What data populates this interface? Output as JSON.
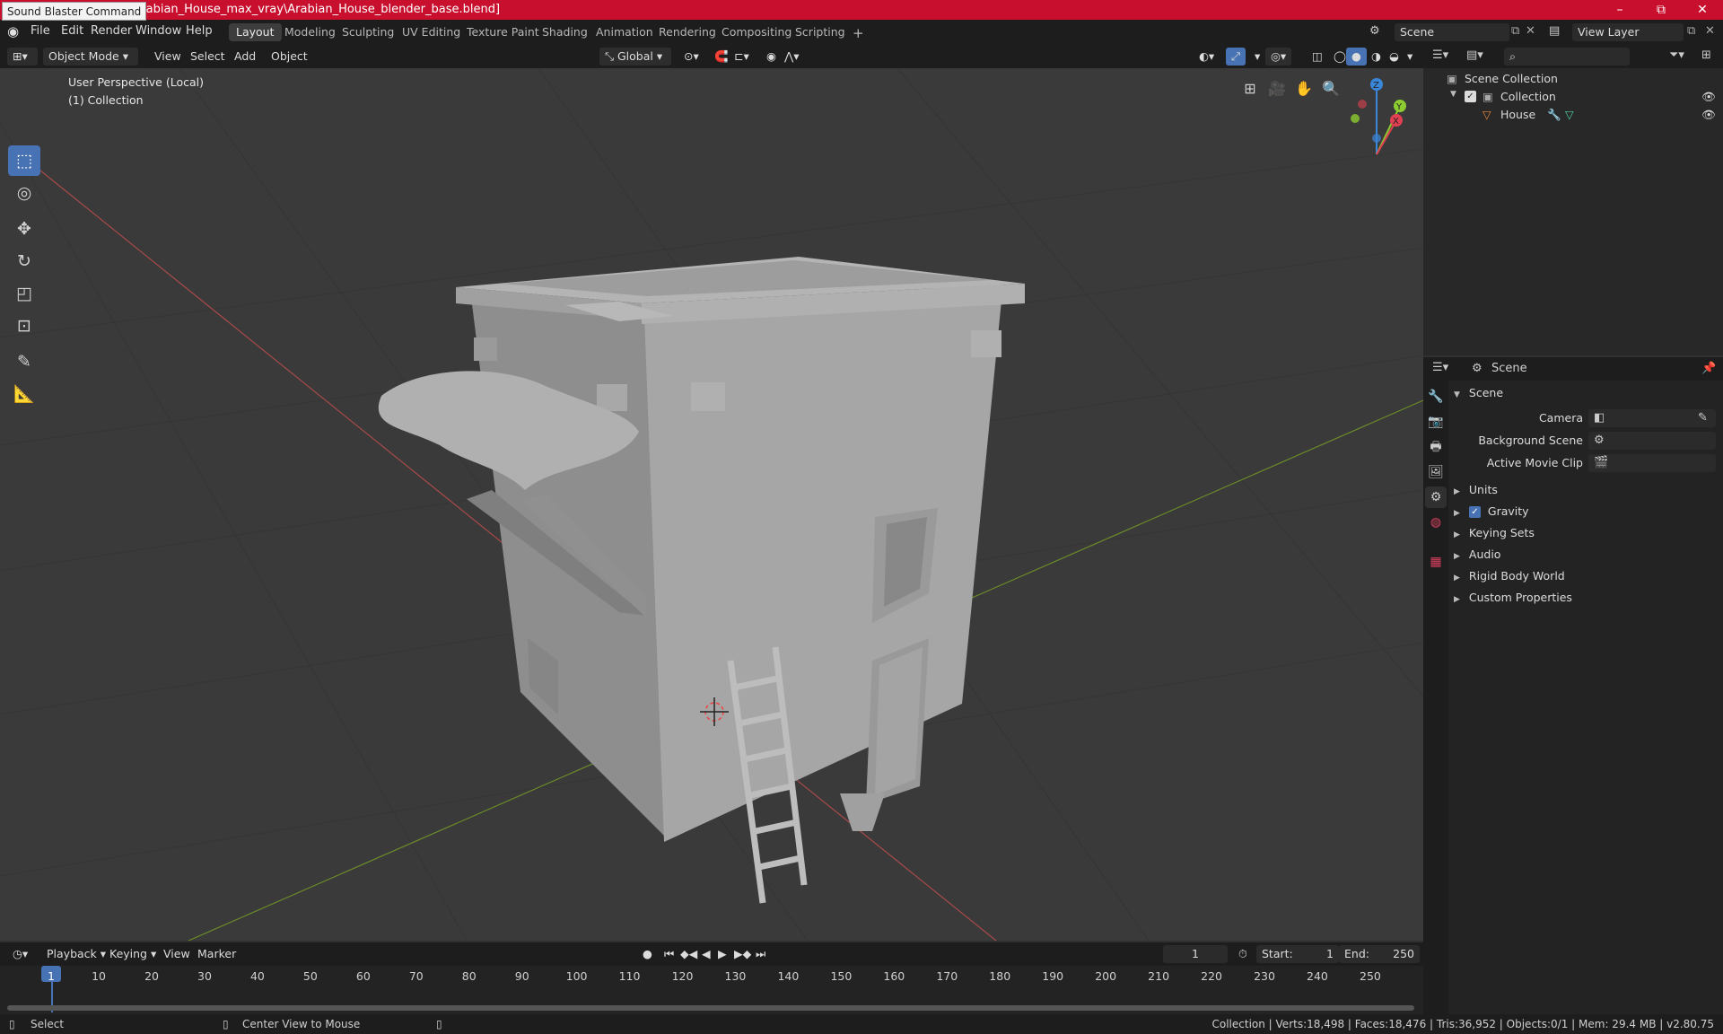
{
  "window": {
    "tooltip": "Sound Blaster Command",
    "title_path": "\\Arabian_House_max_vray\\Arabian_House_blender_base.blend]",
    "controls": {
      "minimize": "–",
      "maximize": "⧉",
      "close": "✕"
    }
  },
  "topbar": {
    "menus": [
      "File",
      "Edit",
      "Render",
      "Window",
      "Help"
    ],
    "workspaces": [
      "Layout",
      "Modeling",
      "Sculpting",
      "UV Editing",
      "Texture Paint",
      "Shading",
      "Animation",
      "Rendering",
      "Compositing",
      "Scripting"
    ],
    "active_workspace": "Layout",
    "add_workspace": "+",
    "scene_name": "Scene",
    "view_layer": "View Layer"
  },
  "viewport_header": {
    "mode": "Object Mode",
    "menus": [
      "View",
      "Select",
      "Add",
      "Object"
    ],
    "transform_orientation": "Global"
  },
  "viewport": {
    "perspective_label": "User Perspective (Local)",
    "collection_label": "(1) Collection",
    "gizmo_axes": {
      "z": "Z",
      "y": "Y",
      "x": "X"
    },
    "colors": {
      "grid_red": "#a84a4a",
      "grid_green": "#6a8a2a",
      "mesh": "#a9a9a9",
      "mesh_shadow": "#858585",
      "gizmo_x": "#e04050",
      "gizmo_y": "#8ccc30",
      "gizmo_z": "#3a86d9"
    }
  },
  "toolbar": {
    "tools": [
      {
        "name": "select-box",
        "glyph": "⬚"
      },
      {
        "name": "cursor",
        "glyph": "◎"
      },
      {
        "name": "move",
        "glyph": "✥"
      },
      {
        "name": "rotate",
        "glyph": "↻"
      },
      {
        "name": "scale",
        "glyph": "◰"
      },
      {
        "name": "transform",
        "glyph": "⊡"
      },
      {
        "name": "annotate",
        "glyph": "✎"
      },
      {
        "name": "measure",
        "glyph": "📐"
      }
    ]
  },
  "outliner": {
    "items": [
      {
        "label": "Scene Collection",
        "depth": 0
      },
      {
        "label": "Collection",
        "depth": 1
      },
      {
        "label": "House",
        "depth": 2
      }
    ]
  },
  "properties": {
    "header": "Scene",
    "section": "Scene",
    "fields": [
      {
        "label": "Camera"
      },
      {
        "label": "Background Scene"
      },
      {
        "label": "Active Movie Clip"
      }
    ],
    "subpanels": [
      "Units",
      "Gravity",
      "Keying Sets",
      "Audio",
      "Rigid Body World",
      "Custom Properties"
    ]
  },
  "timeline": {
    "menus": [
      "Playback",
      "Keying",
      "View",
      "Marker"
    ],
    "current_frame": "1",
    "start_label": "Start:",
    "start": "1",
    "end_label": "End:",
    "end": "250",
    "ticks": [
      "1",
      "10",
      "20",
      "30",
      "40",
      "50",
      "60",
      "70",
      "80",
      "90",
      "100",
      "110",
      "120",
      "130",
      "140",
      "150",
      "160",
      "170",
      "180",
      "190",
      "200",
      "210",
      "220",
      "230",
      "240",
      "250"
    ]
  },
  "statusbar": {
    "left": "Select",
    "middle": "Center View to Mouse",
    "stats": "Collection | Verts:18,498 | Faces:18,476 | Tris:36,952 | Objects:0/1 | Mem: 29.4 MB | v2.80.75"
  }
}
